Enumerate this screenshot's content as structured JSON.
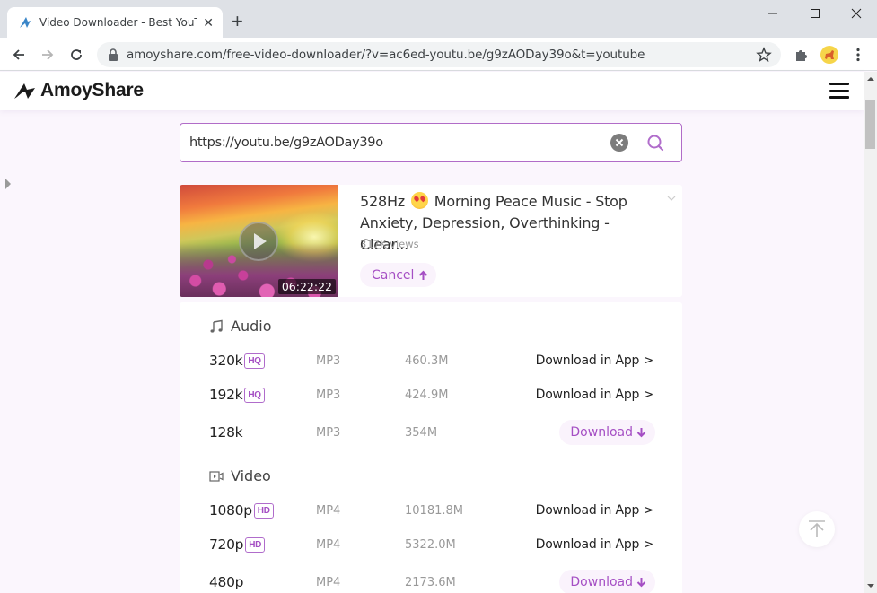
{
  "browser": {
    "tab_title": "Video Downloader - Best YouTube",
    "url": "amoyshare.com/free-video-downloader/?v=ac6ed-youtu.be/g9zAODay39o&t=youtube"
  },
  "site": {
    "brand": "AmoyShare"
  },
  "search": {
    "value": "https://youtu.be/g9zAODay39o"
  },
  "video": {
    "title_prefix": "528Hz",
    "title_rest": "Morning Peace Music - Stop Anxiety, Depression, Overthinking - Clear...",
    "views": "317K views",
    "duration": "06:22:22",
    "cancel_label": "Cancel",
    "cancel_arrow": "🡑"
  },
  "formats": {
    "audio": {
      "label": "Audio",
      "rows": [
        {
          "quality": "320k",
          "badge": "HQ",
          "format": "MP3",
          "size": "460.3M",
          "action": "Download in App >"
        },
        {
          "quality": "192k",
          "badge": "HQ",
          "format": "MP3",
          "size": "424.9M",
          "action": "Download in App >"
        },
        {
          "quality": "128k",
          "badge": "",
          "format": "MP3",
          "size": "354M",
          "action": "Download"
        }
      ]
    },
    "video": {
      "label": "Video",
      "rows": [
        {
          "quality": "1080p",
          "badge": "HD",
          "format": "MP4",
          "size": "10181.8M",
          "action": "Download in App >"
        },
        {
          "quality": "720p",
          "badge": "HD",
          "format": "MP4",
          "size": "5322.0M",
          "action": "Download in App >"
        },
        {
          "quality": "480p",
          "badge": "",
          "format": "MP4",
          "size": "2173.6M",
          "action": "Download"
        }
      ]
    }
  },
  "colors": {
    "accent": "#a54fc4",
    "page_bg": "#fbf6fd"
  }
}
